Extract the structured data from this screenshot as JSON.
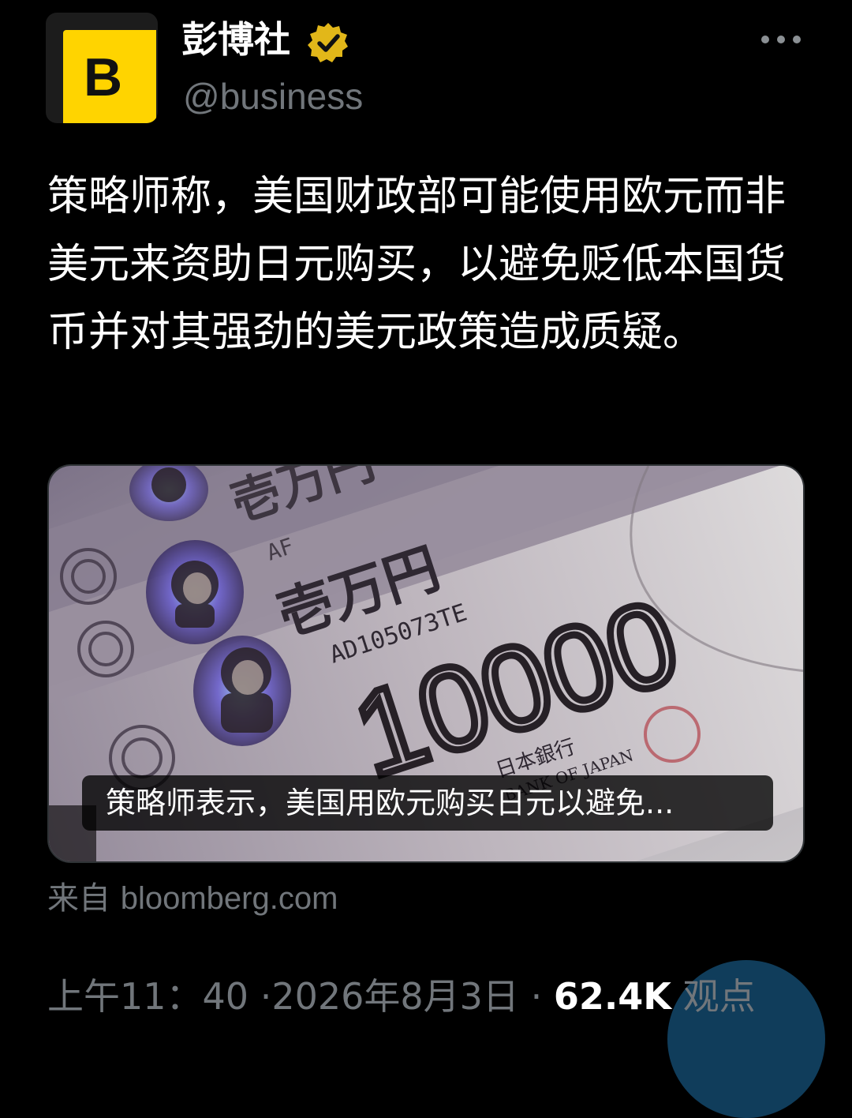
{
  "author": {
    "avatar_letter": "B",
    "display_name": "彭博社",
    "handle": "@business",
    "verified_icon": "verified-badge-icon",
    "brand_color": "#ffd400",
    "verified_color": "#e2b719"
  },
  "menu": {
    "icon": "more-horizontal-icon"
  },
  "tweet": {
    "text": "策略师称，美国财政部可能使用欧元而非美元来资助日元购买，以避免贬低本国货币并对其强劲的美元政策造成质疑。"
  },
  "media": {
    "caption": "策略师表示，美国用欧元购买日元以避免...",
    "banknote_denomination": "10000",
    "banknote_serial": "AD105073TE",
    "banknote_serial_top": "AF",
    "banknote_kanji": "壱万円",
    "banknote_issuer_jp": "日本銀行",
    "banknote_issuer_en": "BANK OF JAPAN"
  },
  "source": {
    "prefix": "来自",
    "domain": "bloomberg.com"
  },
  "meta": {
    "time": "上午11：40",
    "separator": "·",
    "date": "2026年8月3日",
    "views_count": "62.4K",
    "views_label": "观点"
  }
}
